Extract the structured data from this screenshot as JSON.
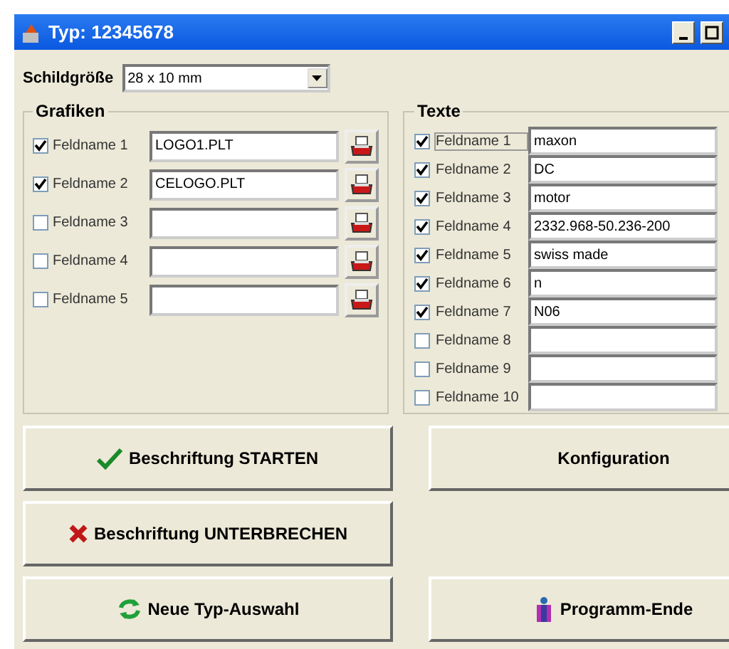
{
  "window": {
    "title": "Typ: 12345678"
  },
  "sign_size": {
    "label": "Schildgröße",
    "value": "28 x 10 mm"
  },
  "graphics": {
    "title": "Grafiken",
    "rows": [
      {
        "label": "Feldname 1",
        "checked": true,
        "value": "LOGO1.PLT"
      },
      {
        "label": "Feldname 2",
        "checked": true,
        "value": "CELOGO.PLT"
      },
      {
        "label": "Feldname 3",
        "checked": false,
        "value": ""
      },
      {
        "label": "Feldname 4",
        "checked": false,
        "value": ""
      },
      {
        "label": "Feldname 5",
        "checked": false,
        "value": ""
      }
    ]
  },
  "texts": {
    "title": "Texte",
    "rows": [
      {
        "label": "Feldname 1",
        "checked": true,
        "focused": true,
        "value": "maxon"
      },
      {
        "label": "Feldname 2",
        "checked": true,
        "focused": false,
        "value": "DC"
      },
      {
        "label": "Feldname 3",
        "checked": true,
        "focused": false,
        "value": "motor"
      },
      {
        "label": "Feldname 4",
        "checked": true,
        "focused": false,
        "value": "2332.968-50.236-200"
      },
      {
        "label": "Feldname 5",
        "checked": true,
        "focused": false,
        "value": "swiss made"
      },
      {
        "label": "Feldname 6",
        "checked": true,
        "focused": false,
        "value": "n"
      },
      {
        "label": "Feldname 7",
        "checked": true,
        "focused": false,
        "value": "N06"
      },
      {
        "label": "Feldname 8",
        "checked": false,
        "focused": false,
        "value": ""
      },
      {
        "label": "Feldname 9",
        "checked": false,
        "focused": false,
        "value": ""
      },
      {
        "label": "Feldname 10",
        "checked": false,
        "focused": false,
        "value": ""
      }
    ]
  },
  "buttons": [
    {
      "label": "Beschriftung STARTEN",
      "kind": "check"
    },
    {
      "label": "Konfiguration",
      "kind": "none"
    },
    {
      "label": "Beschriftung UNTERBRECHEN",
      "kind": "cross"
    },
    {
      "label": "Neue Typ-Auswahl",
      "kind": "refresh"
    },
    {
      "label": "Programm-Ende",
      "kind": "exit"
    }
  ]
}
